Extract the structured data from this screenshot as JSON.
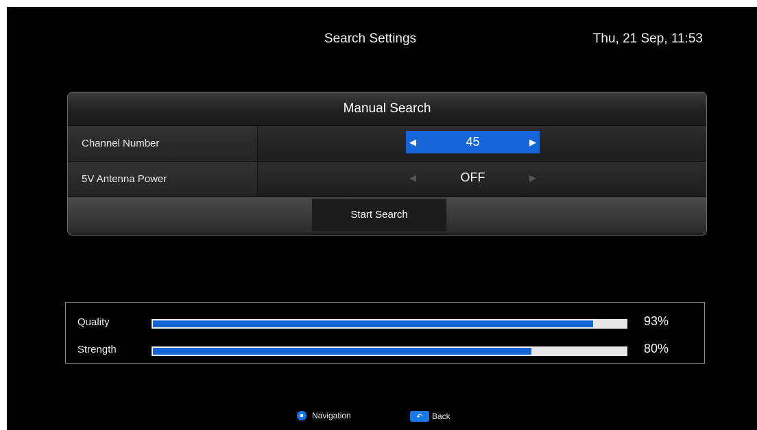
{
  "header": {
    "title": "Search Settings",
    "datetime": "Thu, 21 Sep, 11:53"
  },
  "manual_search": {
    "title": "Manual Search",
    "rows": [
      {
        "label": "Channel Number",
        "value": "45",
        "active": true
      },
      {
        "label": "5V Antenna Power",
        "value": "OFF",
        "active": false
      }
    ],
    "start_button": "Start Search"
  },
  "signal": {
    "quality": {
      "label": "Quality",
      "value_text": "93%",
      "fraction": 0.93
    },
    "strength": {
      "label": "Strength",
      "value_text": "80%",
      "fraction": 0.8
    }
  },
  "footer": {
    "navigation_label": "Navigation",
    "back_label": "Back",
    "icons": [
      "navigation-dpad-icon",
      "back-return-icon"
    ]
  },
  "colors": {
    "accent": "#1565d8",
    "background": "#000000"
  }
}
